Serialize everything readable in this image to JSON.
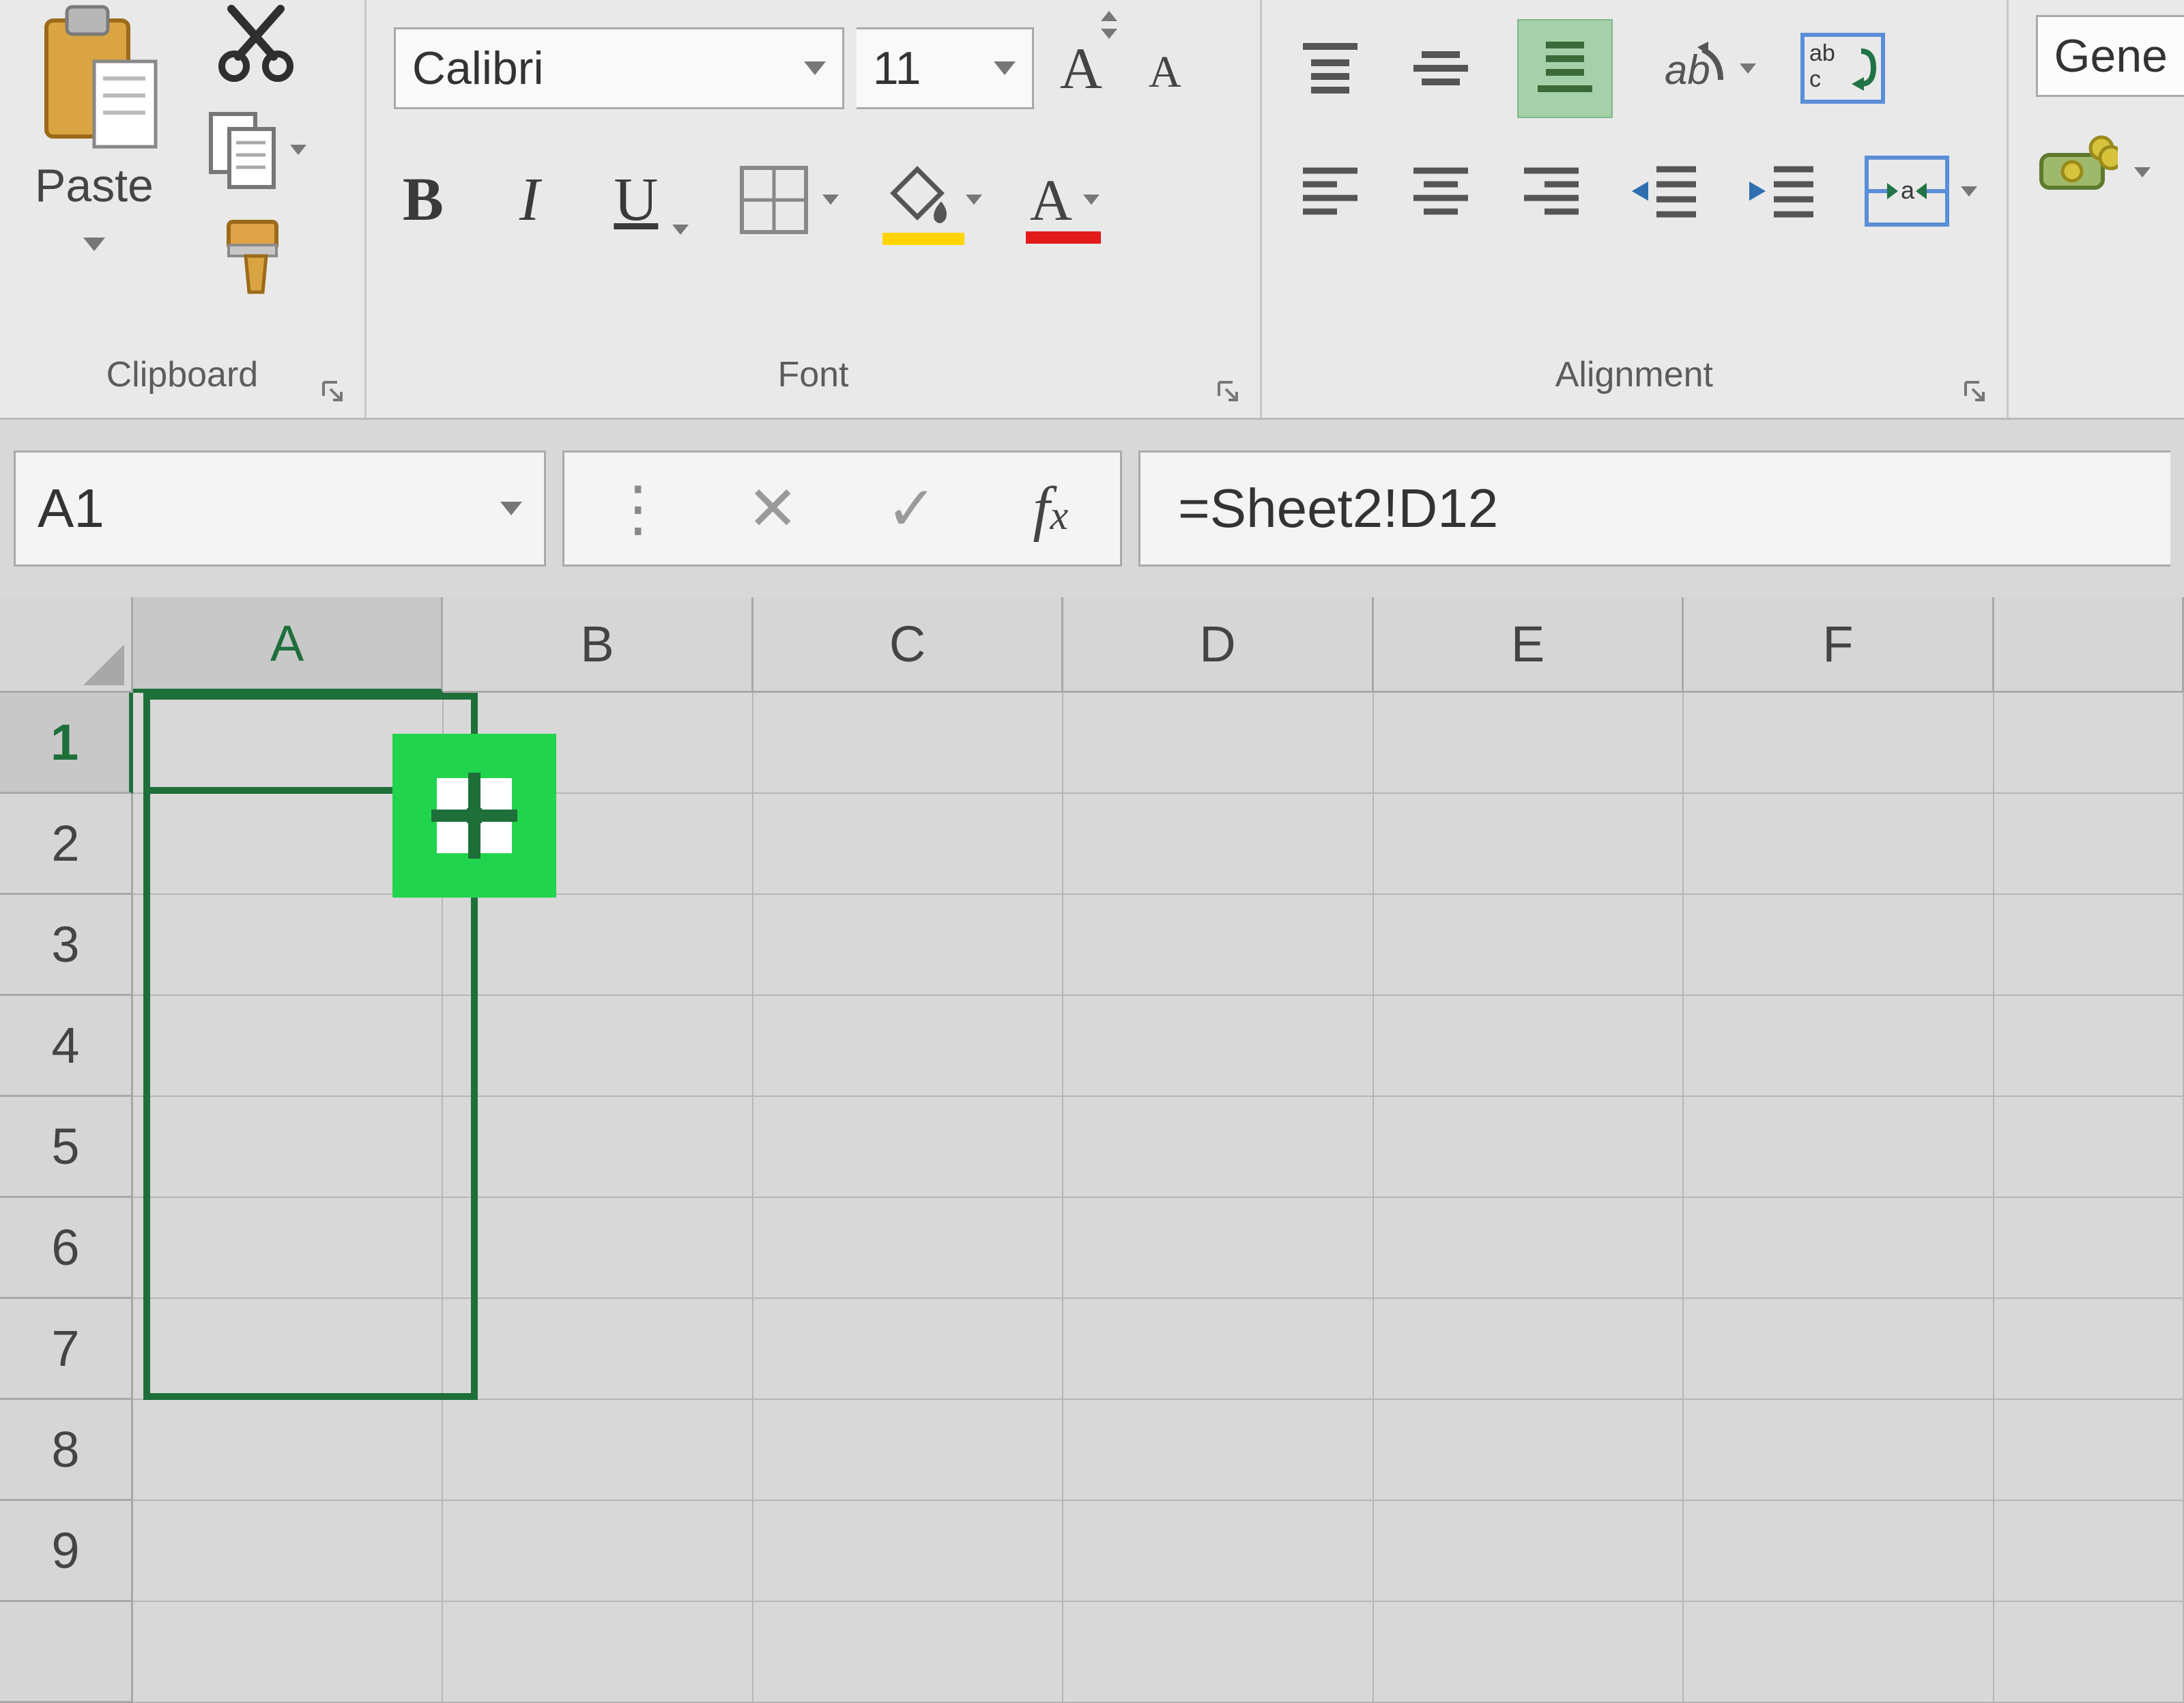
{
  "clipboard": {
    "paste_label": "Paste",
    "group_label": "Clipboard"
  },
  "font": {
    "name": "Calibri",
    "size": "11",
    "group_label": "Font"
  },
  "alignment": {
    "group_label": "Alignment"
  },
  "number": {
    "format": "Gene"
  },
  "formula_bar": {
    "name_box": "A1",
    "formula": "=Sheet2!D12"
  },
  "grid": {
    "columns": [
      "A",
      "B",
      "C",
      "D",
      "E",
      "F"
    ],
    "active_column": "A",
    "rows": [
      "1",
      "2",
      "3",
      "4",
      "5",
      "6",
      "7",
      "8",
      "9"
    ],
    "active_row": "1",
    "selected_cell": "A1",
    "drag_fill_range": "A1:A7"
  },
  "colors": {
    "selection": "#1e6f3a",
    "cursor_highlight": "#22d34d",
    "fill_accent": "#ffd400",
    "font_color_accent": "#e11b1b"
  }
}
